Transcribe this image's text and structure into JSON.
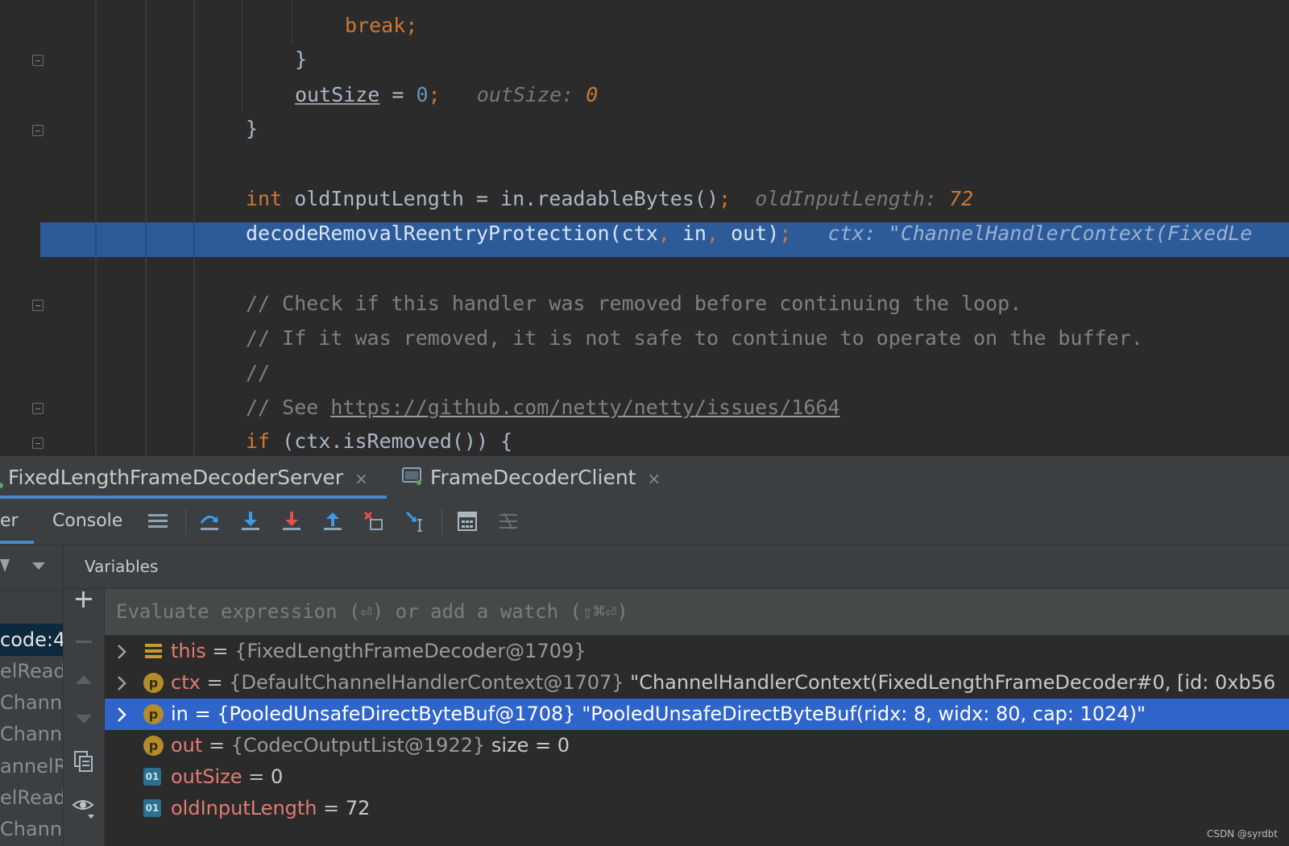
{
  "editor": {
    "l1": {
      "code": "break;"
    },
    "l2": {
      "code": "}"
    },
    "l3": {
      "var": "outSize",
      "op": " = ",
      "num": "0",
      "semi": ";",
      "hint_label": "outSize:",
      "hint_value": "0"
    },
    "l4": {
      "code": "}"
    },
    "l5": {
      "kw": "int",
      "rest": " oldInputLength = in.readableBytes()",
      "semi": ";",
      "hint_label": "oldInputLength:",
      "hint_value": "72"
    },
    "l6": {
      "code1": "decodeRemovalReentryProtection(ctx",
      "comma1": ", ",
      "code2": "in",
      "comma2": ", ",
      "code3": "out)",
      "semi": ";",
      "hint": "ctx: \"ChannelHandlerContext(FixedLe"
    },
    "l7": {
      "comment": "// Check if this handler was removed before continuing the loop."
    },
    "l8": {
      "comment": "// If it was removed, it is not safe to continue to operate on the buffer."
    },
    "l9": {
      "comment": "//"
    },
    "l10": {
      "comment_prefix": "// See ",
      "link": "https://github.com/netty/netty/issues/1664"
    },
    "l11": {
      "kw": "if",
      "rest": " (ctx.isRemoved()) {"
    }
  },
  "run_tabs": [
    {
      "label": "FixedLengthFrameDecoderServer",
      "close": "×"
    },
    {
      "label": "FrameDecoderClient",
      "close": "×"
    }
  ],
  "toolbar": {
    "debugger_tab": "er",
    "console_tab": "Console"
  },
  "variables_title": "Variables",
  "eval_placeholder": "Evaluate expression (⏎) or add a watch (⇧⌘⏎)",
  "frames": [
    "code:4",
    "elRead",
    "Chann",
    "Chann",
    "annelR",
    "elRead",
    "Chann"
  ],
  "variables": [
    {
      "name": "this",
      "eq": " = ",
      "type": "{FixedLengthFrameDecoder@1709}",
      "value": "",
      "icon": "list-icon",
      "expandable": true
    },
    {
      "name": "ctx",
      "eq": " = ",
      "type": "{DefaultChannelHandlerContext@1707}",
      "value": " \"ChannelHandlerContext(FixedLengthFrameDecoder#0, [id: 0xb56",
      "icon": "p",
      "expandable": true
    },
    {
      "name": "in",
      "eq": " = ",
      "type": "{PooledUnsafeDirectByteBuf@1708}",
      "value": " \"PooledUnsafeDirectByteBuf(ridx: 8, widx: 80, cap: 1024)\"",
      "icon": "p",
      "expandable": true
    },
    {
      "name": "out",
      "eq": " = ",
      "type": "{CodecOutputList@1922}",
      "value": "  size = 0",
      "icon": "p",
      "expandable": false
    },
    {
      "name": "outSize",
      "eq": " = ",
      "type": "",
      "value": "0",
      "icon": "01",
      "expandable": false
    },
    {
      "name": "oldInputLength",
      "eq": " = ",
      "type": "",
      "value": "72",
      "icon": "01",
      "expandable": false
    }
  ],
  "watermark": "CSDN @syrdbt",
  "colors": {
    "highlight": "#2d5b9a",
    "selection": "#2f65ca",
    "keyword": "#cc7832",
    "number": "#6897bb",
    "var_name": "#e47a73"
  }
}
